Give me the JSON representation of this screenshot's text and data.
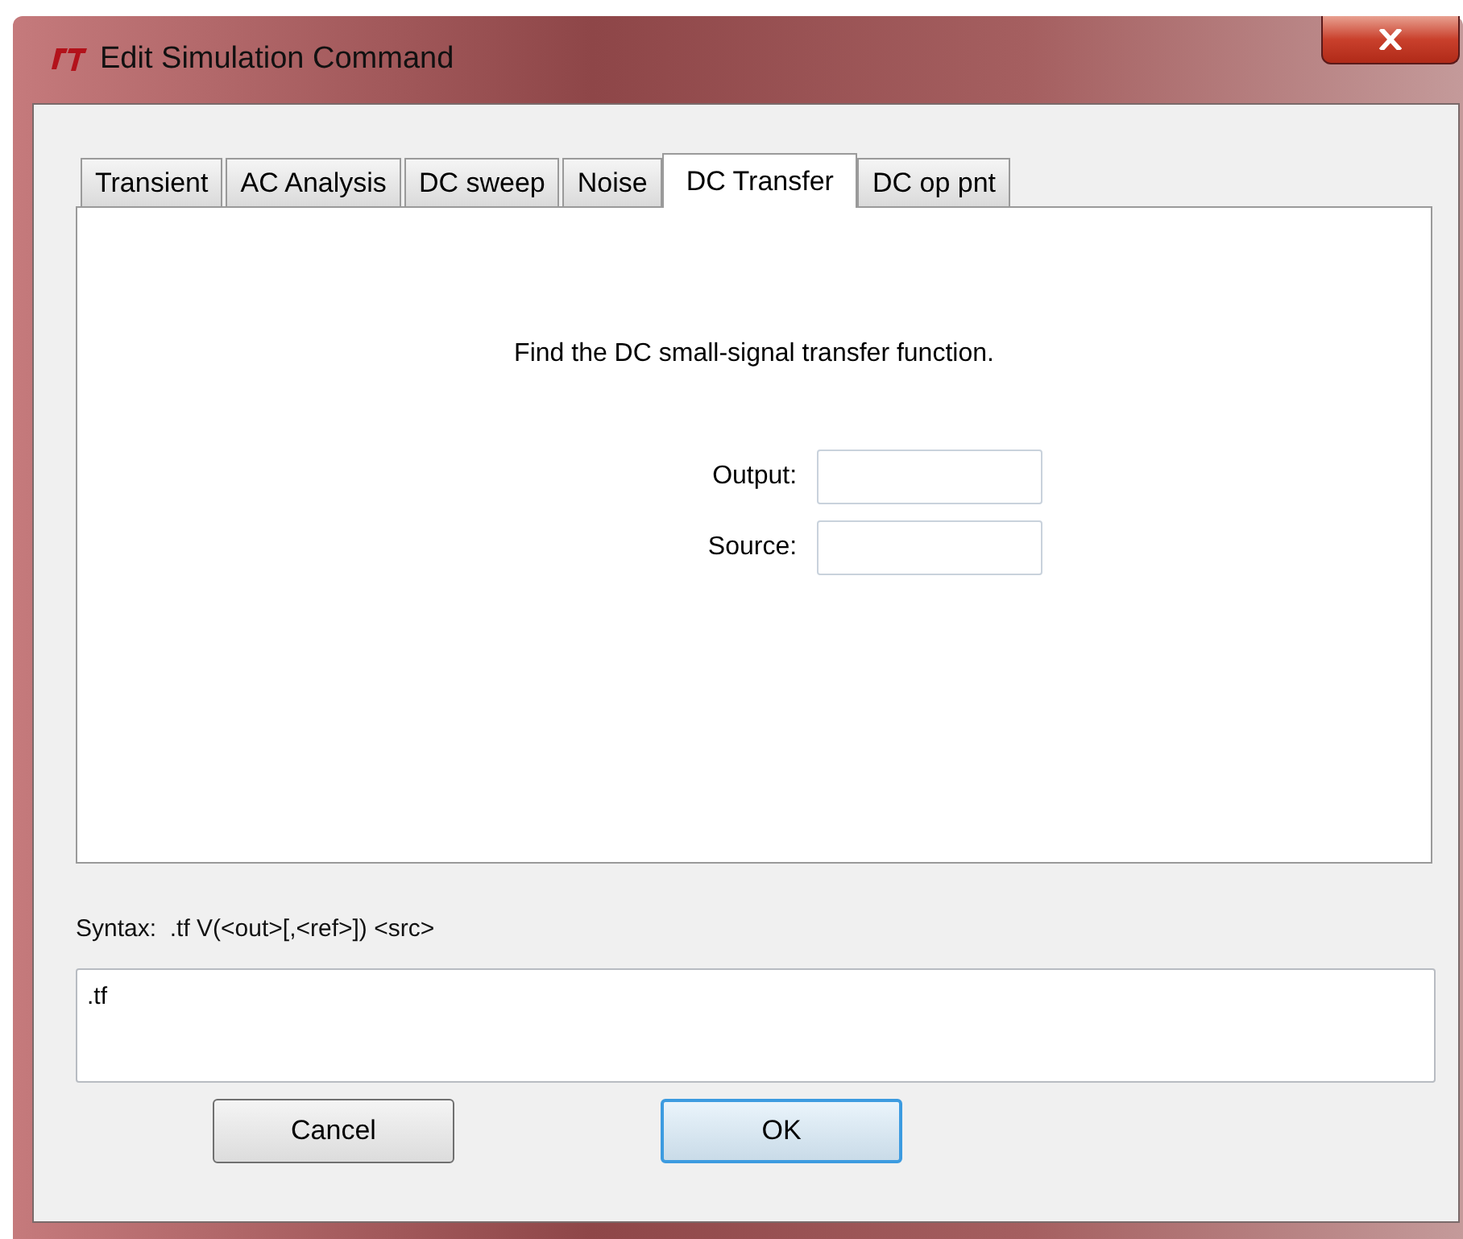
{
  "window": {
    "title": "Edit Simulation Command"
  },
  "tabs": [
    {
      "label": "Transient",
      "selected": false
    },
    {
      "label": "AC Analysis",
      "selected": false
    },
    {
      "label": "DC sweep",
      "selected": false
    },
    {
      "label": "Noise",
      "selected": false
    },
    {
      "label": "DC Transfer",
      "selected": true
    },
    {
      "label": "DC op pnt",
      "selected": false
    }
  ],
  "panel": {
    "description": "Find the DC small-signal transfer function.",
    "fields": [
      {
        "label": "Output:"
      },
      {
        "label": "Source:"
      }
    ]
  },
  "syntax": "Syntax:  .tf V(<out>[,<ref>]) <src>",
  "command": ".tf",
  "buttons": [
    {
      "label": "Cancel",
      "default": false
    },
    {
      "label": "OK",
      "default": true
    }
  ]
}
